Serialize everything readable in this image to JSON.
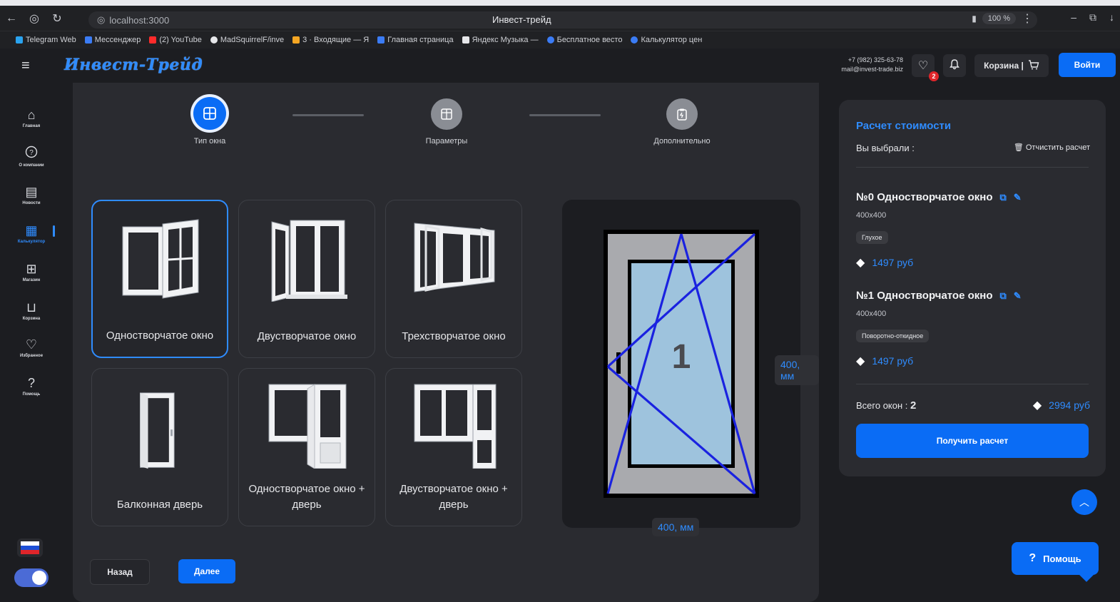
{
  "browser": {
    "url": "localhost:3000",
    "tab_title": "Инвест-трейд",
    "zoom": "100 %",
    "bookmarks": [
      {
        "label": "Telegram Web",
        "color": "#2aa3ef"
      },
      {
        "label": "Мессенджер",
        "color": "#3b7cf5"
      },
      {
        "label": "(2) YouTube",
        "color": "#ff2b2b"
      },
      {
        "label": "MadSquirrelF/inve",
        "color": "#e6e7ea"
      },
      {
        "label": "3 · Входящие — Я",
        "color": "#f5a623"
      },
      {
        "label": "Главная страница",
        "color": "#3b7cf5"
      },
      {
        "label": "Яндекс Музыка —",
        "color": "#e6e7ea"
      },
      {
        "label": "Бесплатное весто",
        "color": "#3b7cf5"
      },
      {
        "label": "Калькулятор цен",
        "color": "#3b7cf5"
      }
    ]
  },
  "header": {
    "logo": "Инвест-Трейд",
    "phone": "+7 (982) 325-63-78",
    "email": "mail@invest-trade.biz",
    "favorites_count": "2",
    "cart_label": "Корзина |",
    "login_label": "Войти"
  },
  "sidebar": {
    "items": [
      {
        "label": "Главная",
        "icon": "home-icon",
        "glyph": "⌂"
      },
      {
        "label": "О компании",
        "icon": "question-circle-icon",
        "glyph": "?"
      },
      {
        "label": "Новости",
        "icon": "news-icon",
        "glyph": "▤"
      },
      {
        "label": "Калькулятор",
        "icon": "calculator-icon",
        "glyph": "▦"
      },
      {
        "label": "Магазин",
        "icon": "shop-icon",
        "glyph": "⊞"
      },
      {
        "label": "Корзина",
        "icon": "cart-icon",
        "glyph": "⊔"
      },
      {
        "label": "Избранное",
        "icon": "heart-icon",
        "glyph": "♡"
      },
      {
        "label": "Помощь",
        "icon": "help-icon",
        "glyph": "?"
      }
    ]
  },
  "steps": [
    {
      "label": "Тип окна",
      "active": true
    },
    {
      "label": "Параметры",
      "active": false
    },
    {
      "label": "Дополнительно",
      "active": false
    }
  ],
  "window_types": [
    {
      "name": "Одностворчатое окно",
      "selected": true
    },
    {
      "name": "Двустворчатое окно",
      "selected": false
    },
    {
      "name": "Трехстворчатое окно",
      "selected": false
    },
    {
      "name": "Балконная дверь",
      "selected": false
    },
    {
      "name": "Одностворчатое окно + дверь",
      "selected": false
    },
    {
      "name": "Двустворчатое окно + дверь",
      "selected": false
    }
  ],
  "preview": {
    "sash_number": "1",
    "height_label": "400, мм",
    "width_label": "400, мм"
  },
  "nav": {
    "back": "Назад",
    "next": "Далее"
  },
  "summary": {
    "title": "Расчет стоимости",
    "chosen_label": "Вы выбрали :",
    "clear_label": "Отчистить расчет",
    "items": [
      {
        "title": "№0 Одностворчатое окно",
        "size": "400x400",
        "tag": "Глухое",
        "price": "1497 руб"
      },
      {
        "title": "№1 Одностворчатое окно",
        "size": "400x400",
        "tag": "Поворотно-откидное",
        "price": "1497 руб"
      }
    ],
    "total_label": "Всего окон :",
    "total_count": "2",
    "total_price": "2994 руб",
    "cta": "Получить расчет"
  },
  "help_label": "Помощь",
  "colors": {
    "accent": "#0a6cf5",
    "link": "#2f8cff",
    "panel": "#2a2b30",
    "background": "#1c1d21"
  }
}
